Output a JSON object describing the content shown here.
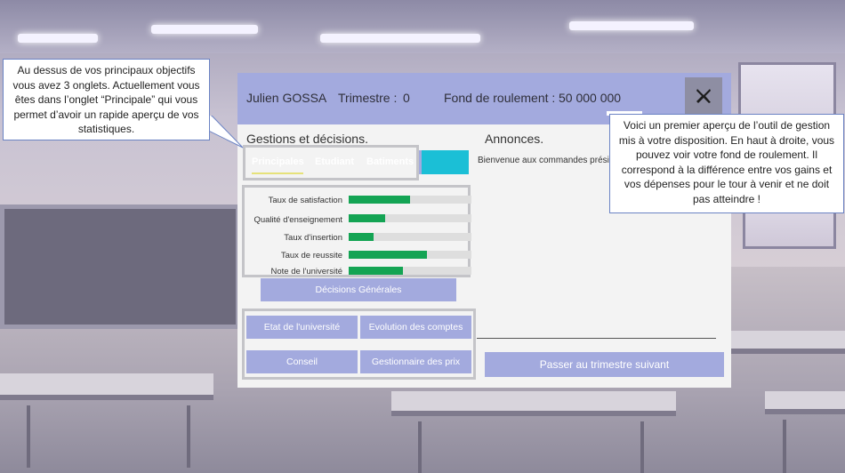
{
  "header": {
    "player_name": "Julien GOSSA",
    "trimester_label": "Trimestre :",
    "trimester_value": "0",
    "fund_label": "Fond de roulement :",
    "fund_value": "50 000 000",
    "close_label": "X"
  },
  "left": {
    "title": "Gestions et décisions.",
    "tabs": [
      {
        "label": "Principales",
        "active": true
      },
      {
        "label": "Etudiant",
        "active": false
      },
      {
        "label": "Batiments",
        "active": false
      }
    ],
    "stats": [
      {
        "label": "Taux de satisfaction",
        "value": 0.5
      },
      {
        "label": "Qualité d'enseignement",
        "value": 0.3
      },
      {
        "label": "Taux d'insertion",
        "value": 0.2
      },
      {
        "label": "Taux de reussite",
        "value": 0.64
      },
      {
        "label": "Note de l'université",
        "value": 0.44
      }
    ],
    "decisions_button": "Décisions Générales",
    "action_buttons": [
      "Etat de l'université",
      "Evolution des comptes",
      "Conseil",
      "Gestionnaire des prix"
    ]
  },
  "right": {
    "title": "Annonces.",
    "message": "Bienvenue aux commandes prési",
    "next_button": "Passer au trimestre suivant"
  },
  "callouts": {
    "left": "Au dessus de vos principaux objectifs vous avez 3 onglets. Actuellement vous êtes dans l’onglet “Principale” qui vous permet d’avoir un rapide aperçu de vos statistiques.",
    "right": "Voici un premier aperçu de l’outil de gestion mis à votre disposition. En haut à droite, vous pouvez voir votre fond de roulement. Il correspond à la différence entre vos gains et vos dépenses pour le tour à venir et ne doit pas atteindre !"
  },
  "colors": {
    "accent": "#a3aade",
    "progress": "#14a454",
    "tab_cyan": "#1bbfd6"
  }
}
